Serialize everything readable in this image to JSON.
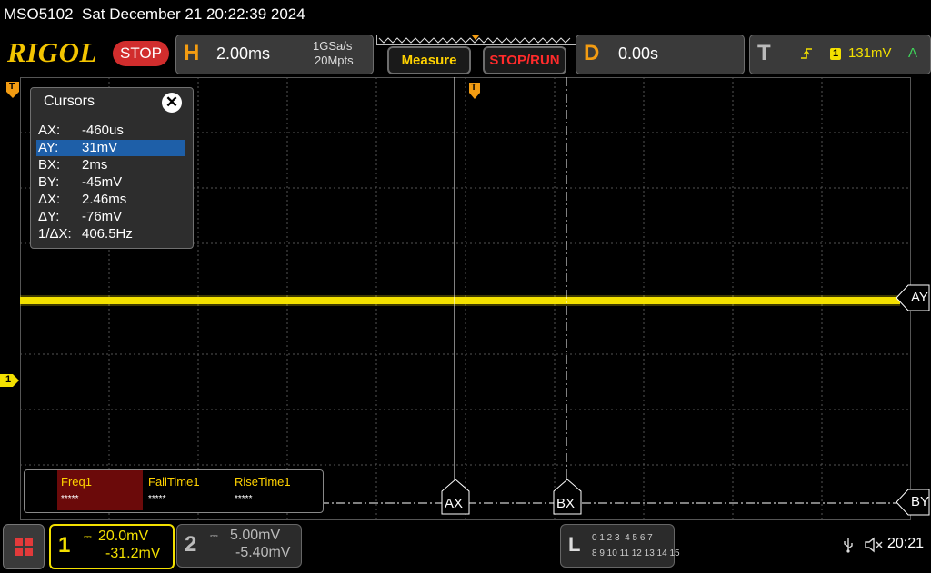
{
  "title_bar": {
    "text": "MSO5102  Sat December 21 20:22:39 2024"
  },
  "toolbar": {
    "logo": "RIGOL",
    "run_state": "STOP",
    "horizontal": {
      "key": "H",
      "timebase": "2.00ms",
      "sample_rate": "1GSa/s",
      "memory_depth": "20Mpts"
    },
    "measure_button": "Measure",
    "stop_run_button": "STOP/RUN",
    "delay": {
      "key": "D",
      "value": "0.00s"
    },
    "trigger": {
      "key": "T",
      "channel": "1",
      "level": "131mV",
      "mode": "A"
    }
  },
  "colors": {
    "ch1": "#f3e000",
    "accent_orange": "#f39c12",
    "stop_red": "#d12d2d",
    "cursor_highlight": "#1e5fa8"
  },
  "cursors_panel": {
    "title": "Cursors",
    "rows": [
      {
        "key": "AX:",
        "value": "-460us"
      },
      {
        "key": "AY:",
        "value": "31mV",
        "selected": true
      },
      {
        "key": "BX:",
        "value": "2ms"
      },
      {
        "key": "BY:",
        "value": "-45mV"
      },
      {
        "key": "ΔX:",
        "value": "2.46ms"
      },
      {
        "key": "ΔY:",
        "value": "-76mV"
      },
      {
        "key": "1/ΔX:",
        "value": "406.5Hz"
      }
    ]
  },
  "cursor_labels": {
    "ax": "AX",
    "bx": "BX",
    "ay": "AY",
    "by": "BY"
  },
  "markers": {
    "ch1_marker": "1",
    "trigger_marker": "T"
  },
  "measurements": [
    {
      "label": "Freq1",
      "value": "*****"
    },
    {
      "label": "FallTime1",
      "value": "*****"
    },
    {
      "label": "RiseTime1",
      "value": "*****"
    }
  ],
  "channels": {
    "ch1": {
      "number": "1",
      "scale": "20.0mV",
      "offset": "-31.2mV"
    },
    "ch2": {
      "number": "2",
      "scale": "5.00mV",
      "offset": "-5.40mV"
    }
  },
  "logic_analyzer": {
    "key": "L",
    "row1": "0 1 2 3  4 5 6 7",
    "row2": "8 9 10 11 12 13 14 15"
  },
  "status": {
    "clock": "20:21"
  }
}
